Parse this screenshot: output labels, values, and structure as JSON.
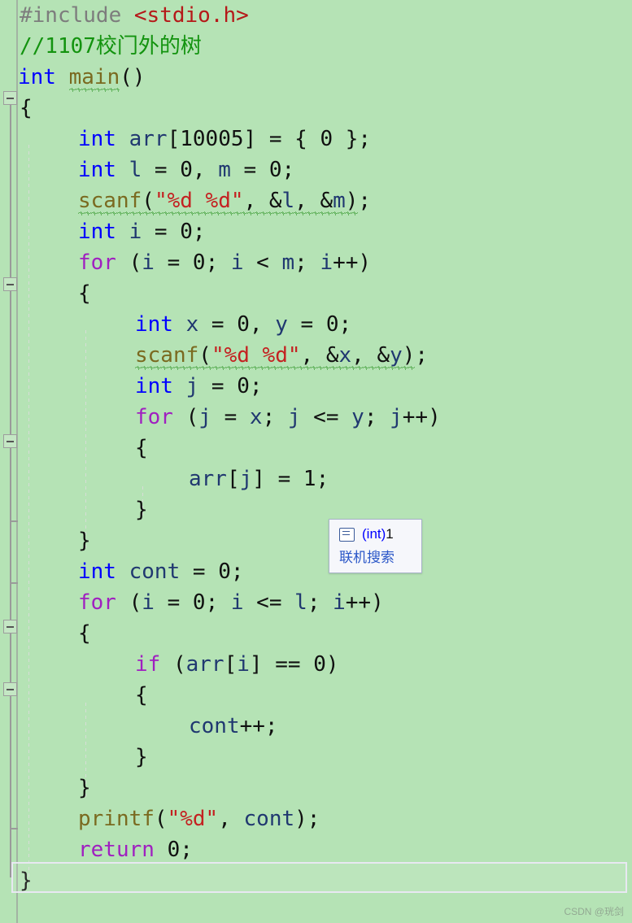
{
  "editor": {
    "language": "c",
    "background_color": "#b5e3b5",
    "font_size_px": 26,
    "line_height_px": 38
  },
  "code_lines": [
    {
      "n": 1,
      "indent": 0,
      "text": "#include <stdio.h>"
    },
    {
      "n": 2,
      "indent": 0,
      "text": "//1107校门外的树"
    },
    {
      "n": 3,
      "indent": 0,
      "text": "int main()"
    },
    {
      "n": 4,
      "indent": 0,
      "text": "{"
    },
    {
      "n": 5,
      "indent": 1,
      "text": "int arr[10005] = { 0 };"
    },
    {
      "n": 6,
      "indent": 1,
      "text": "int l = 0, m = 0;"
    },
    {
      "n": 7,
      "indent": 1,
      "text": "scanf(\"%d %d\", &l, &m);"
    },
    {
      "n": 8,
      "indent": 1,
      "text": "int i = 0;"
    },
    {
      "n": 9,
      "indent": 1,
      "text": "for (i = 0; i < m; i++)"
    },
    {
      "n": 10,
      "indent": 1,
      "text": "{"
    },
    {
      "n": 11,
      "indent": 2,
      "text": "int x = 0, y = 0;"
    },
    {
      "n": 12,
      "indent": 2,
      "text": "scanf(\"%d %d\", &x, &y);"
    },
    {
      "n": 13,
      "indent": 2,
      "text": "int j = 0;"
    },
    {
      "n": 14,
      "indent": 2,
      "text": "for (j = x; j <= y; j++)"
    },
    {
      "n": 15,
      "indent": 2,
      "text": "{"
    },
    {
      "n": 16,
      "indent": 3,
      "text": "arr[j] = 1;"
    },
    {
      "n": 17,
      "indent": 2,
      "text": "}"
    },
    {
      "n": 18,
      "indent": 1,
      "text": "}"
    },
    {
      "n": 19,
      "indent": 1,
      "text": "int cont = 0;"
    },
    {
      "n": 20,
      "indent": 1,
      "text": "for (i = 0; i <= l; i++)"
    },
    {
      "n": 21,
      "indent": 1,
      "text": "{"
    },
    {
      "n": 22,
      "indent": 2,
      "text": "if (arr[i] == 0)"
    },
    {
      "n": 23,
      "indent": 2,
      "text": "{"
    },
    {
      "n": 24,
      "indent": 3,
      "text": "cont++;"
    },
    {
      "n": 25,
      "indent": 2,
      "text": "}"
    },
    {
      "n": 26,
      "indent": 1,
      "text": "}"
    },
    {
      "n": 27,
      "indent": 1,
      "text": "printf(\"%d\", cont);"
    },
    {
      "n": 28,
      "indent": 1,
      "text": "return 0;"
    },
    {
      "n": 29,
      "indent": 0,
      "text": "}"
    }
  ],
  "tooltip": {
    "icon": "field-icon",
    "type_cast": "(int)",
    "value": "1",
    "link_label": "联机搜索"
  },
  "watermark": {
    "text": "CSDN @珖剑"
  },
  "colors": {
    "background": "#b5e3b5",
    "keyword": "#0000ff",
    "control_keyword": "#a020c0",
    "function": "#7a6a20",
    "string": "#c42121",
    "comment": "#13930f",
    "preprocessor": "#7d7d7d",
    "header": "#b51919",
    "identifier": "#203870",
    "squiggle": "#1e8a14",
    "tooltip_link": "#2b57c8"
  }
}
